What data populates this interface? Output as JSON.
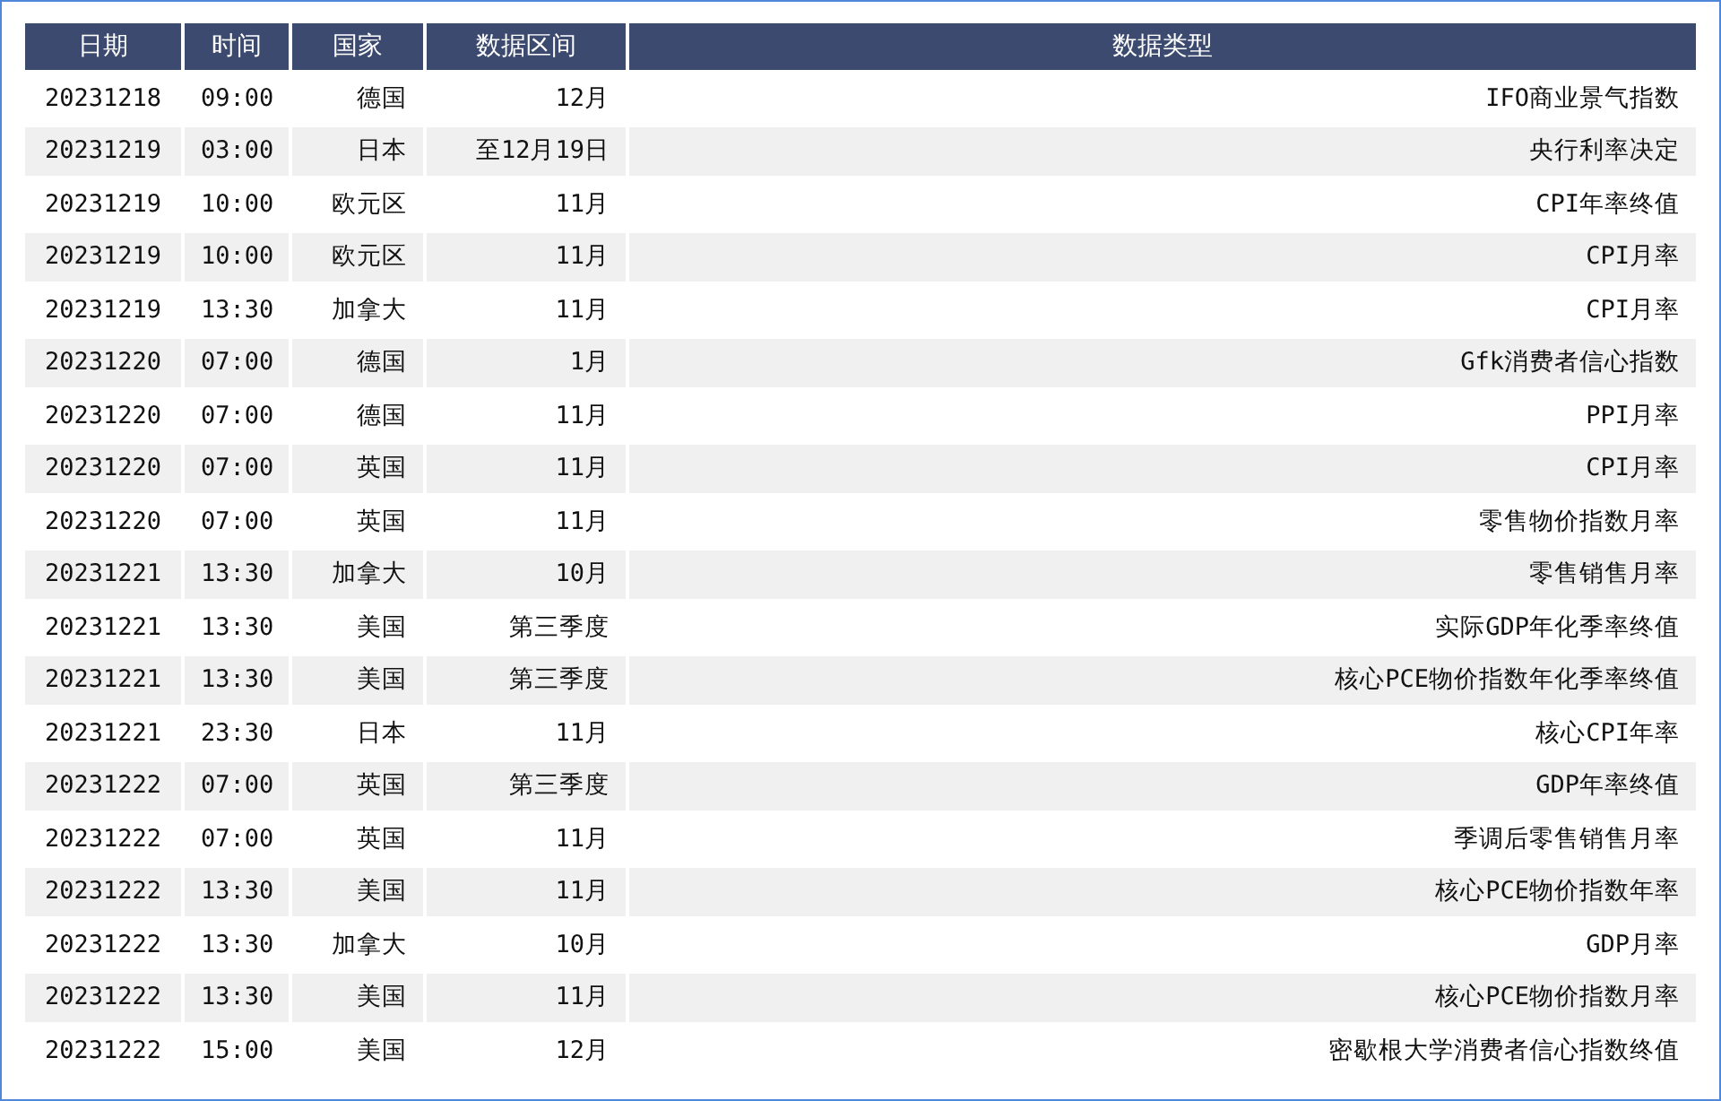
{
  "table": {
    "columns": [
      "日期",
      "时间",
      "国家",
      "数据区间",
      "数据类型"
    ],
    "rows": [
      [
        "20231218",
        "09:00",
        "德国",
        "12月",
        "IFO商业景气指数"
      ],
      [
        "20231219",
        "03:00",
        "日本",
        "至12月19日",
        "央行利率决定"
      ],
      [
        "20231219",
        "10:00",
        "欧元区",
        "11月",
        "CPI年率终值"
      ],
      [
        "20231219",
        "10:00",
        "欧元区",
        "11月",
        "CPI月率"
      ],
      [
        "20231219",
        "13:30",
        "加拿大",
        "11月",
        "CPI月率"
      ],
      [
        "20231220",
        "07:00",
        "德国",
        "1月",
        "Gfk消费者信心指数"
      ],
      [
        "20231220",
        "07:00",
        "德国",
        "11月",
        "PPI月率"
      ],
      [
        "20231220",
        "07:00",
        "英国",
        "11月",
        "CPI月率"
      ],
      [
        "20231220",
        "07:00",
        "英国",
        "11月",
        "零售物价指数月率"
      ],
      [
        "20231221",
        "13:30",
        "加拿大",
        "10月",
        "零售销售月率"
      ],
      [
        "20231221",
        "13:30",
        "美国",
        "第三季度",
        "实际GDP年化季率终值"
      ],
      [
        "20231221",
        "13:30",
        "美国",
        "第三季度",
        "核心PCE物价指数年化季率终值"
      ],
      [
        "20231221",
        "23:30",
        "日本",
        "11月",
        "核心CPI年率"
      ],
      [
        "20231222",
        "07:00",
        "英国",
        "第三季度",
        "GDP年率终值"
      ],
      [
        "20231222",
        "07:00",
        "英国",
        "11月",
        "季调后零售销售月率"
      ],
      [
        "20231222",
        "13:30",
        "美国",
        "11月",
        "核心PCE物价指数年率"
      ],
      [
        "20231222",
        "13:30",
        "加拿大",
        "10月",
        "GDP月率"
      ],
      [
        "20231222",
        "13:30",
        "美国",
        "11月",
        "核心PCE物价指数月率"
      ],
      [
        "20231222",
        "15:00",
        "美国",
        "12月",
        "密歇根大学消费者信心指数终值"
      ]
    ]
  }
}
